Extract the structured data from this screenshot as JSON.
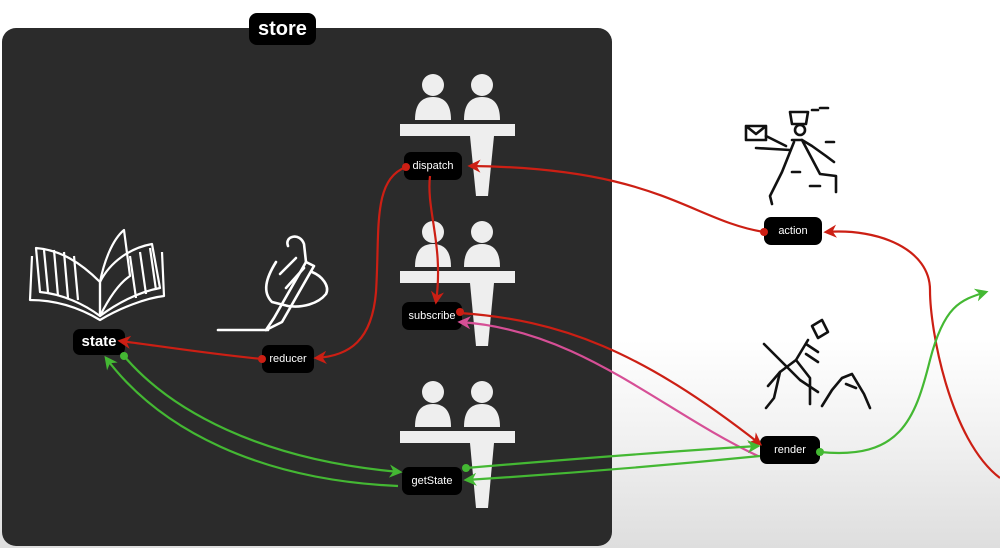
{
  "store": {
    "label": "store"
  },
  "nodes": {
    "state": "state",
    "reducer": "reducer",
    "dispatch": "dispatch",
    "subscribe": "subscribe",
    "getState": "getState",
    "action": "action",
    "render": "render"
  },
  "colors": {
    "store_bg": "#2b2b2b",
    "node_bg": "#000000",
    "red_flow": "#cc1f14",
    "green_flow": "#44b833",
    "pink_flow": "#d64f96"
  },
  "icons": {
    "state": "open-book-icon",
    "reducer": "writing-hand-icon",
    "counters": "service-counter-people-icon",
    "action": "mail-courier-icon",
    "render": "worker-digging-icon"
  }
}
